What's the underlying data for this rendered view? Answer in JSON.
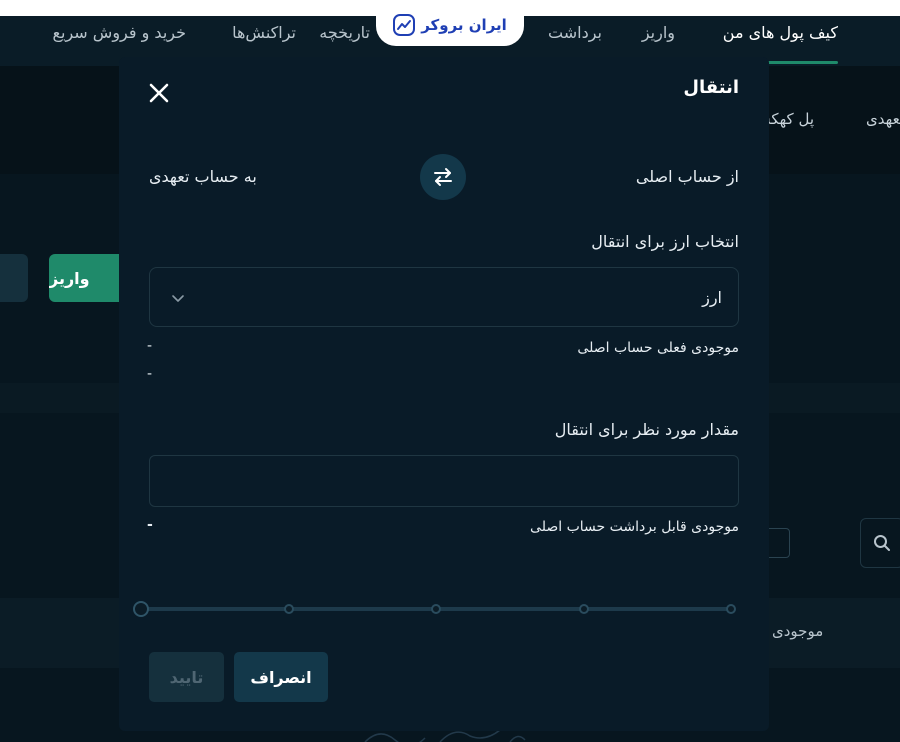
{
  "brand": {
    "name": "ایران بروکر"
  },
  "nav": {
    "items": [
      {
        "label": "کیف پول های من",
        "active": true
      },
      {
        "label": "واریز"
      },
      {
        "label": "برداشت"
      },
      {
        "label": "تاریخچه"
      },
      {
        "label": "تراکنش‌ها"
      },
      {
        "label": "خرید و فروش سریع"
      }
    ]
  },
  "subnav": {
    "items": [
      "تعهدی",
      "پل کهکشانی"
    ]
  },
  "background": {
    "deposit_button": "واریز",
    "balance_label": "موجودی"
  },
  "modal": {
    "title": "انتقال",
    "from_label": "از حساب اصلی",
    "to_label": "به حساب تعهدی",
    "currency_section_label": "انتخاب ارز برای انتقال",
    "currency_select_value": "ارز",
    "current_balance_label": "موجودی فعلی حساب اصلی",
    "current_balance_value": "-",
    "secondary_balance_value": "-",
    "amount_label": "مقدار مورد نظر برای انتقال",
    "amount_value": "",
    "withdrawable_label": "موجودی قابل برداشت حساب اصلی",
    "withdrawable_value": "-",
    "slider": {
      "value_percent": 0,
      "steps": [
        0,
        25,
        50,
        75,
        100
      ]
    },
    "cancel_button": "انصراف",
    "confirm_button": "تایید"
  },
  "colors": {
    "background": "#07161f",
    "modal": "#091b28",
    "accent_green": "#1f8a6a",
    "secondary_button": "#13384a",
    "brand_blue": "#1f3fb4"
  }
}
